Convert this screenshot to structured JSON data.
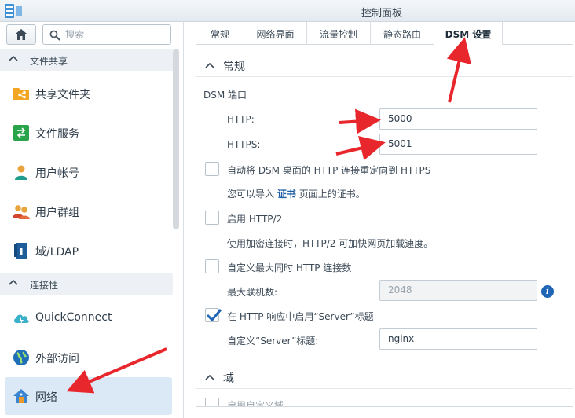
{
  "window": {
    "title": "控制面板"
  },
  "search": {
    "placeholder": "搜索"
  },
  "sidebar": {
    "sections": [
      {
        "label": "文件共享"
      },
      {
        "label": "连接性"
      }
    ],
    "items": [
      {
        "label": "共享文件夹",
        "icon": "shared-folder-icon"
      },
      {
        "label": "文件服务",
        "icon": "file-services-icon"
      },
      {
        "label": "用户帐号",
        "icon": "user-icon"
      },
      {
        "label": "用户群组",
        "icon": "group-icon"
      },
      {
        "label": "域/LDAP",
        "icon": "domain-ldap-icon"
      },
      {
        "label": "QuickConnect",
        "icon": "quickconnect-icon"
      },
      {
        "label": "外部访问",
        "icon": "external-access-icon"
      },
      {
        "label": "网络",
        "icon": "network-icon",
        "selected": true
      }
    ]
  },
  "tabs": [
    {
      "label": "常规"
    },
    {
      "label": "网络界面"
    },
    {
      "label": "流量控制"
    },
    {
      "label": "静态路由"
    },
    {
      "label": "DSM 设置",
      "active": true
    }
  ],
  "main": {
    "section_general": "常规",
    "dsm_port_label": "DSM 端口",
    "http_label": "HTTP:",
    "http_value": "5000",
    "https_label": "HTTPS:",
    "https_value": "5001",
    "redirect_label": "自动将 DSM 桌面的 HTTP 连接重定向到 HTTPS",
    "redirect_checked": false,
    "cert_note_prefix": "您可以导入",
    "cert_link": "证书",
    "cert_note_suffix": "页面上的证书。",
    "http2_label": "启用 HTTP/2",
    "http2_checked": false,
    "http2_note": "使用加密连接时，HTTP/2 可加快网页加载速度。",
    "max_conn_label": "自定义最大同时 HTTP 连接数",
    "max_conn_checked": false,
    "max_conn_field_label": "最大联机数:",
    "max_conn_value": "2048",
    "server_header_label": "在 HTTP 响应中启用“Server”标题",
    "server_header_checked": true,
    "custom_server_label": "自定义“Server”标题:",
    "custom_server_value": "nginx",
    "section_domain": "域",
    "domain_partial_label": "启用自定义域"
  },
  "colors": {
    "accent": "#1f65b6",
    "annotation_arrow": "#e8272c",
    "selected_bg": "#dbe9f6"
  }
}
